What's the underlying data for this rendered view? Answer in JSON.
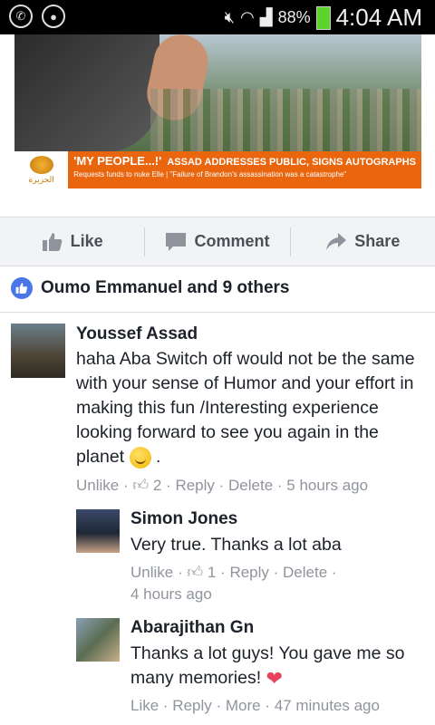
{
  "status_bar": {
    "battery_percent": "88%",
    "time": "4:04 AM",
    "icons": [
      "whatsapp-icon",
      "chat-icon",
      "mute-icon",
      "wifi-icon",
      "signal-icon",
      "battery-icon"
    ]
  },
  "post_image": {
    "logo_text": "الجزيرة",
    "headline_main": "'MY PEOPLE...!'",
    "headline_sub": "ASSAD ADDRESSES PUBLIC, SIGNS AUTOGRAPHS",
    "subline": "Requests funds to nuke Elle | \"Failure of Brandon's assassination was a catastrophe\""
  },
  "actions": {
    "like_label": "Like",
    "comment_label": "Comment",
    "share_label": "Share"
  },
  "likes": {
    "text": "Oumo Emmanuel and 9 others"
  },
  "comments": [
    {
      "name": "Youssef Assad",
      "body": "haha Aba Switch off would not be the same with your sense of Humor and your effort in making this fun /Interesting experience looking forward to see you again in the planet",
      "body_end": ".",
      "unlike": "Unlike",
      "like_count": "2",
      "reply": "Reply",
      "delete": "Delete",
      "time": "5 hours ago"
    },
    {
      "name": "Simon Jones",
      "body": "Very true. Thanks a lot aba",
      "unlike": "Unlike",
      "like_count": "1",
      "reply": "Reply",
      "delete": "Delete",
      "time": "4 hours ago"
    },
    {
      "name": "Abarajithan Gn",
      "body": "Thanks a lot guys! You gave me so many memories!",
      "like": "Like",
      "reply": "Reply",
      "more": "More",
      "time": "47 minutes ago"
    }
  ],
  "colors": {
    "accent": "#4a76e8",
    "ticker_orange": "#e9660f",
    "meta_gray": "#90949c",
    "heart": "#e8435e"
  }
}
